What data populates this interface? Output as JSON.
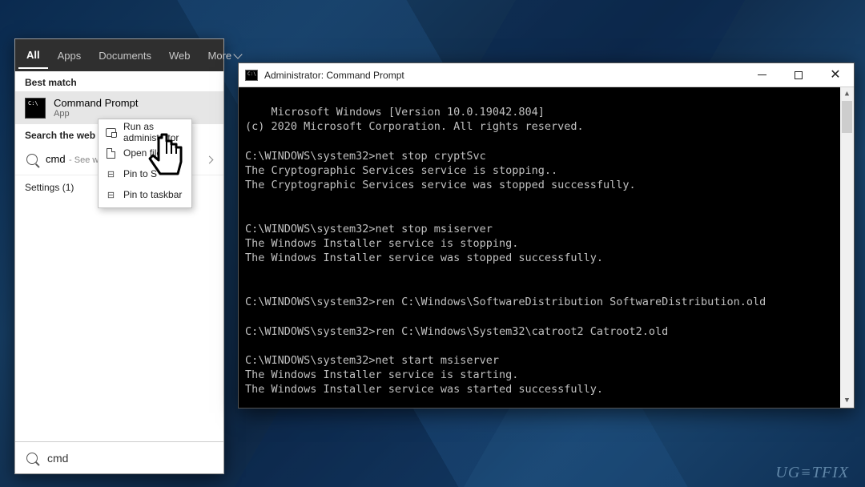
{
  "watermark": "UG≡TFIX",
  "search_panel": {
    "tabs": {
      "all": "All",
      "apps": "Apps",
      "documents": "Documents",
      "web": "Web",
      "more": "More"
    },
    "best_match_label": "Best match",
    "result": {
      "title": "Command Prompt",
      "subtitle": "App"
    },
    "search_web_label": "Search the web",
    "web_query": "cmd",
    "web_subtitle": "- See we",
    "settings_label": "Settings (1)",
    "input_value": "cmd"
  },
  "context_menu": {
    "run_admin": "Run as administrator",
    "open_file": "Open file",
    "pin_start": "Pin to S",
    "pin_taskbar": "Pin to taskbar"
  },
  "cmd_window": {
    "title": "Administrator: Command Prompt",
    "lines": "Microsoft Windows [Version 10.0.19042.804]\n(c) 2020 Microsoft Corporation. All rights reserved.\n\nC:\\WINDOWS\\system32>net stop cryptSvc\nThe Cryptographic Services service is stopping..\nThe Cryptographic Services service was stopped successfully.\n\n\nC:\\WINDOWS\\system32>net stop msiserver\nThe Windows Installer service is stopping.\nThe Windows Installer service was stopped successfully.\n\n\nC:\\WINDOWS\\system32>ren C:\\Windows\\SoftwareDistribution SoftwareDistribution.old\n\nC:\\WINDOWS\\system32>ren C:\\Windows\\System32\\catroot2 Catroot2.old\n\nC:\\WINDOWS\\system32>net start msiserver\nThe Windows Installer service is starting.\nThe Windows Installer service was started successfully.\n\n\nC:\\WINDOWS\\system32>net start cryptSvc\nThe Cryptographic Services service is starting.\nThe Cryptographic Services service was started successfully."
  }
}
